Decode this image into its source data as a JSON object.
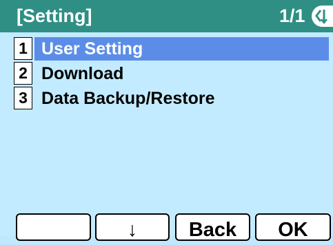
{
  "header": {
    "title": "[Setting]",
    "page": "1/1",
    "nav_icon": "back-arrow-icon"
  },
  "menu": {
    "items": [
      {
        "num": "1",
        "label": "User Setting",
        "selected": true
      },
      {
        "num": "2",
        "label": "Download",
        "selected": false
      },
      {
        "num": "3",
        "label": "Data Backup/Restore",
        "selected": false
      }
    ]
  },
  "softkeys": {
    "key1": "",
    "key2": "↓",
    "key3": "Back",
    "key4": "OK"
  },
  "colors": {
    "title_bar": "#2f8f84",
    "screen_bg": "#c3ebff",
    "selection": "#5b8de8"
  }
}
